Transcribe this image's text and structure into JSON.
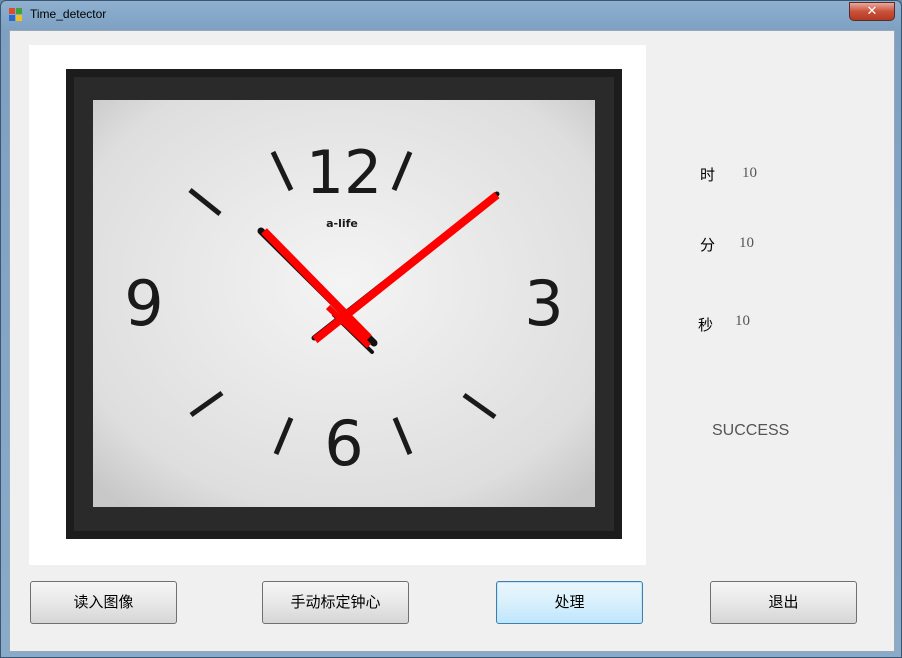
{
  "window": {
    "title": "Time_detector",
    "close_label": "✕"
  },
  "results": {
    "hour_label": "时",
    "hour_value": "10",
    "minute_label": "分",
    "minute_value": "10",
    "second_label": "秒",
    "second_value": "10",
    "status": "SUCCESS"
  },
  "clock": {
    "brand": "a-life",
    "numerals": {
      "twelve": "12",
      "three": "3",
      "six": "6",
      "nine": "9"
    },
    "hand_color": "#ff0000"
  },
  "buttons": {
    "load_image": "读入图像",
    "calibrate_center": "手动标定钟心",
    "process": "处理",
    "exit": "退出"
  },
  "icons": {
    "app": "app-icon",
    "close": "close-icon"
  }
}
